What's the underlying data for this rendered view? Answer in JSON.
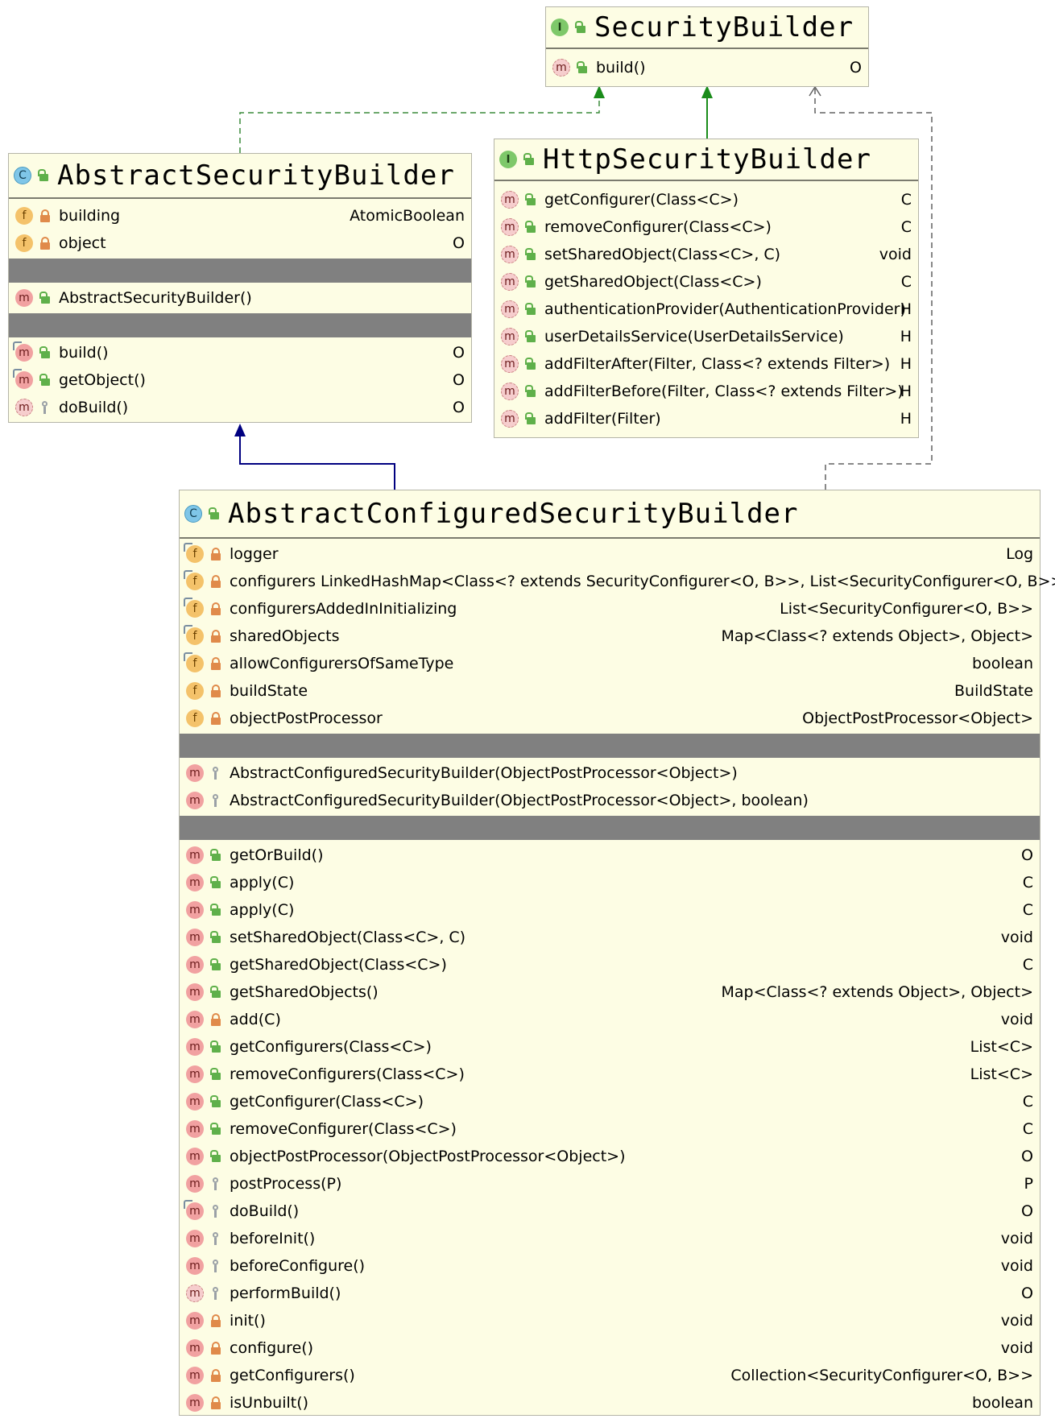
{
  "colors": {
    "box_bg": "#fdfde4",
    "separator": "#808080",
    "extends_edge": "#000080",
    "interface_edge": "#008000",
    "implements_edge": "#3a6b3a",
    "dependency_edge": "#606060"
  },
  "security_builder": {
    "kind_icon": "I",
    "title": "SecurityBuilder",
    "methods": [
      {
        "kind": "m",
        "vis": "public",
        "name": "build()",
        "type": "O",
        "abstract": true
      }
    ]
  },
  "http_security_builder": {
    "kind_icon": "I",
    "title": "HttpSecurityBuilder",
    "methods": [
      {
        "kind": "m",
        "vis": "public",
        "name": "getConfigurer(Class<C>)",
        "type": "C",
        "abstract": true
      },
      {
        "kind": "m",
        "vis": "public",
        "name": "removeConfigurer(Class<C>)",
        "type": "C",
        "abstract": true
      },
      {
        "kind": "m",
        "vis": "public",
        "name": "setSharedObject(Class<C>, C)",
        "type": "void",
        "abstract": true
      },
      {
        "kind": "m",
        "vis": "public",
        "name": "getSharedObject(Class<C>)",
        "type": "C",
        "abstract": true
      },
      {
        "kind": "m",
        "vis": "public",
        "name": "authenticationProvider(AuthenticationProvider)",
        "type": "H",
        "abstract": true
      },
      {
        "kind": "m",
        "vis": "public",
        "name": "userDetailsService(UserDetailsService)",
        "type": "H",
        "abstract": true
      },
      {
        "kind": "m",
        "vis": "public",
        "name": "addFilterAfter(Filter, Class<? extends Filter>)",
        "type": "H",
        "abstract": true
      },
      {
        "kind": "m",
        "vis": "public",
        "name": "addFilterBefore(Filter, Class<? extends Filter>)",
        "type": "H",
        "abstract": true
      },
      {
        "kind": "m",
        "vis": "public",
        "name": "addFilter(Filter)",
        "type": "H",
        "abstract": true
      }
    ]
  },
  "abstract_security_builder": {
    "kind_icon": "C",
    "title": "AbstractSecurityBuilder",
    "fields": [
      {
        "kind": "f",
        "vis": "private",
        "name": "building",
        "type": "AtomicBoolean"
      },
      {
        "kind": "f",
        "vis": "private",
        "name": "object",
        "type": "O"
      }
    ],
    "constructors": [
      {
        "kind": "m",
        "vis": "public",
        "name": "AbstractSecurityBuilder()",
        "type": ""
      }
    ],
    "methods": [
      {
        "kind": "m",
        "vis": "public",
        "name": "build()",
        "type": "O",
        "inherited": true
      },
      {
        "kind": "m",
        "vis": "public",
        "name": "getObject()",
        "type": "O",
        "inherited": true
      },
      {
        "kind": "m",
        "vis": "protected",
        "name": "doBuild()",
        "type": "O",
        "abstract": true
      }
    ]
  },
  "abstract_configured_security_builder": {
    "kind_icon": "C",
    "title": "AbstractConfiguredSecurityBuilder",
    "fields": [
      {
        "kind": "f",
        "vis": "private",
        "name": "logger",
        "type": "Log",
        "inherited": true
      },
      {
        "kind": "f",
        "vis": "private",
        "name": "configurers LinkedHashMap<Class<? extends SecurityConfigurer<O, B>>, List<SecurityConfigurer<O, B>>>",
        "type": "",
        "inherited": true
      },
      {
        "kind": "f",
        "vis": "private",
        "name": "configurersAddedInInitializing",
        "type": "List<SecurityConfigurer<O, B>>",
        "inherited": true
      },
      {
        "kind": "f",
        "vis": "private",
        "name": "sharedObjects",
        "type": "Map<Class<? extends Object>, Object>",
        "inherited": true
      },
      {
        "kind": "f",
        "vis": "private",
        "name": "allowConfigurersOfSameType",
        "type": "boolean",
        "inherited": true
      },
      {
        "kind": "f",
        "vis": "private",
        "name": "buildState",
        "type": "BuildState"
      },
      {
        "kind": "f",
        "vis": "private",
        "name": "objectPostProcessor",
        "type": "ObjectPostProcessor<Object>"
      }
    ],
    "constructors": [
      {
        "kind": "m",
        "vis": "protected",
        "name": "AbstractConfiguredSecurityBuilder(ObjectPostProcessor<Object>)",
        "type": ""
      },
      {
        "kind": "m",
        "vis": "protected",
        "name": "AbstractConfiguredSecurityBuilder(ObjectPostProcessor<Object>, boolean)",
        "type": ""
      }
    ],
    "methods": [
      {
        "kind": "m",
        "vis": "public",
        "name": "getOrBuild()",
        "type": "O"
      },
      {
        "kind": "m",
        "vis": "public",
        "name": "apply(C)",
        "type": "C"
      },
      {
        "kind": "m",
        "vis": "public",
        "name": "apply(C)",
        "type": "C"
      },
      {
        "kind": "m",
        "vis": "public",
        "name": "setSharedObject(Class<C>, C)",
        "type": "void"
      },
      {
        "kind": "m",
        "vis": "public",
        "name": "getSharedObject(Class<C>)",
        "type": "C"
      },
      {
        "kind": "m",
        "vis": "public",
        "name": "getSharedObjects()",
        "type": "Map<Class<? extends Object>, Object>"
      },
      {
        "kind": "m",
        "vis": "private",
        "name": "add(C)",
        "type": "void"
      },
      {
        "kind": "m",
        "vis": "public",
        "name": "getConfigurers(Class<C>)",
        "type": "List<C>"
      },
      {
        "kind": "m",
        "vis": "public",
        "name": "removeConfigurers(Class<C>)",
        "type": "List<C>"
      },
      {
        "kind": "m",
        "vis": "public",
        "name": "getConfigurer(Class<C>)",
        "type": "C"
      },
      {
        "kind": "m",
        "vis": "public",
        "name": "removeConfigurer(Class<C>)",
        "type": "C"
      },
      {
        "kind": "m",
        "vis": "public",
        "name": "objectPostProcessor(ObjectPostProcessor<Object>)",
        "type": "O"
      },
      {
        "kind": "m",
        "vis": "protected",
        "name": "postProcess(P)",
        "type": "P"
      },
      {
        "kind": "m",
        "vis": "protected",
        "name": "doBuild()",
        "type": "O",
        "inherited": true
      },
      {
        "kind": "m",
        "vis": "protected",
        "name": "beforeInit()",
        "type": "void"
      },
      {
        "kind": "m",
        "vis": "protected",
        "name": "beforeConfigure()",
        "type": "void"
      },
      {
        "kind": "m",
        "vis": "protected",
        "name": "performBuild()",
        "type": "O",
        "abstract": true
      },
      {
        "kind": "m",
        "vis": "private",
        "name": "init()",
        "type": "void"
      },
      {
        "kind": "m",
        "vis": "private",
        "name": "configure()",
        "type": "void"
      },
      {
        "kind": "m",
        "vis": "private",
        "name": "getConfigurers()",
        "type": "Collection<SecurityConfigurer<O, B>>"
      },
      {
        "kind": "m",
        "vis": "private",
        "name": "isUnbuilt()",
        "type": "boolean"
      }
    ]
  }
}
